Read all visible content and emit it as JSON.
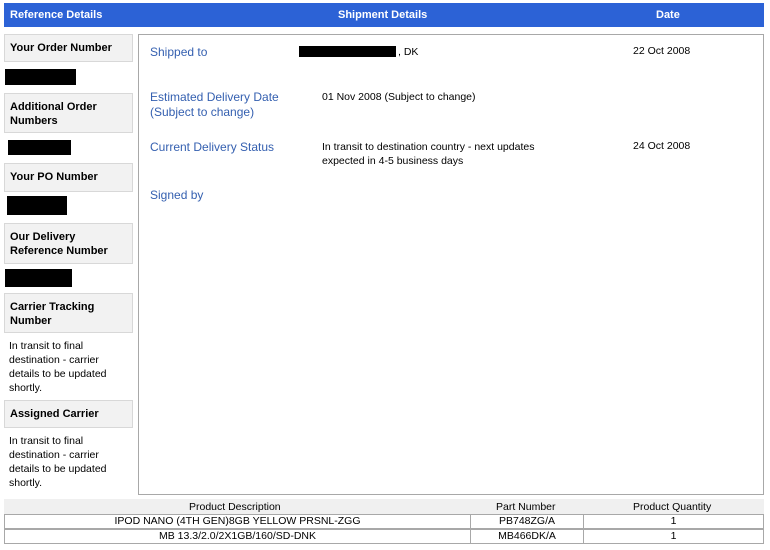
{
  "header": {
    "reference_details": "Reference Details",
    "shipment_details": "Shipment Details",
    "date": "Date"
  },
  "left": {
    "order_number_label": "Your Order Number",
    "additional_order_label": "Additional Order Numbers",
    "po_number_label": "Your PO Number",
    "delivery_ref_label": "Our Delivery Reference Number",
    "tracking_label": "Carrier Tracking Number",
    "tracking_text": "In transit to final destination - carrier details to be updated shortly.",
    "carrier_label": "Assigned Carrier",
    "carrier_text": "In transit to final destination - carrier details to be updated shortly."
  },
  "main": {
    "shipped_to_label": "Shipped to",
    "shipped_to_suffix": ", DK",
    "shipped_to_date": "22 Oct 2008",
    "est_delivery_label": "Estimated Delivery Date (Subject to change)",
    "est_delivery_value": "01 Nov 2008 (Subject to change)",
    "status_label": "Current Delivery Status",
    "status_value": "In transit to destination country - next updates expected in 4-5 business days",
    "status_date": "24 Oct 2008",
    "signed_by_label": "Signed by"
  },
  "products": {
    "headers": {
      "description": "Product Description",
      "part_number": "Part Number",
      "quantity": "Product Quantity"
    },
    "rows": [
      {
        "description": "IPOD NANO (4TH GEN)8GB YELLOW PRSNL-ZGG",
        "part_number": "PB748ZG/A",
        "quantity": "1"
      },
      {
        "description": "MB 13.3/2.0/2X1GB/160/SD-DNK",
        "part_number": "MB466DK/A",
        "quantity": "1"
      }
    ]
  },
  "colors": {
    "header_bg": "#2c62d6",
    "label_blue": "#3560b0",
    "redaction": "#000000"
  }
}
